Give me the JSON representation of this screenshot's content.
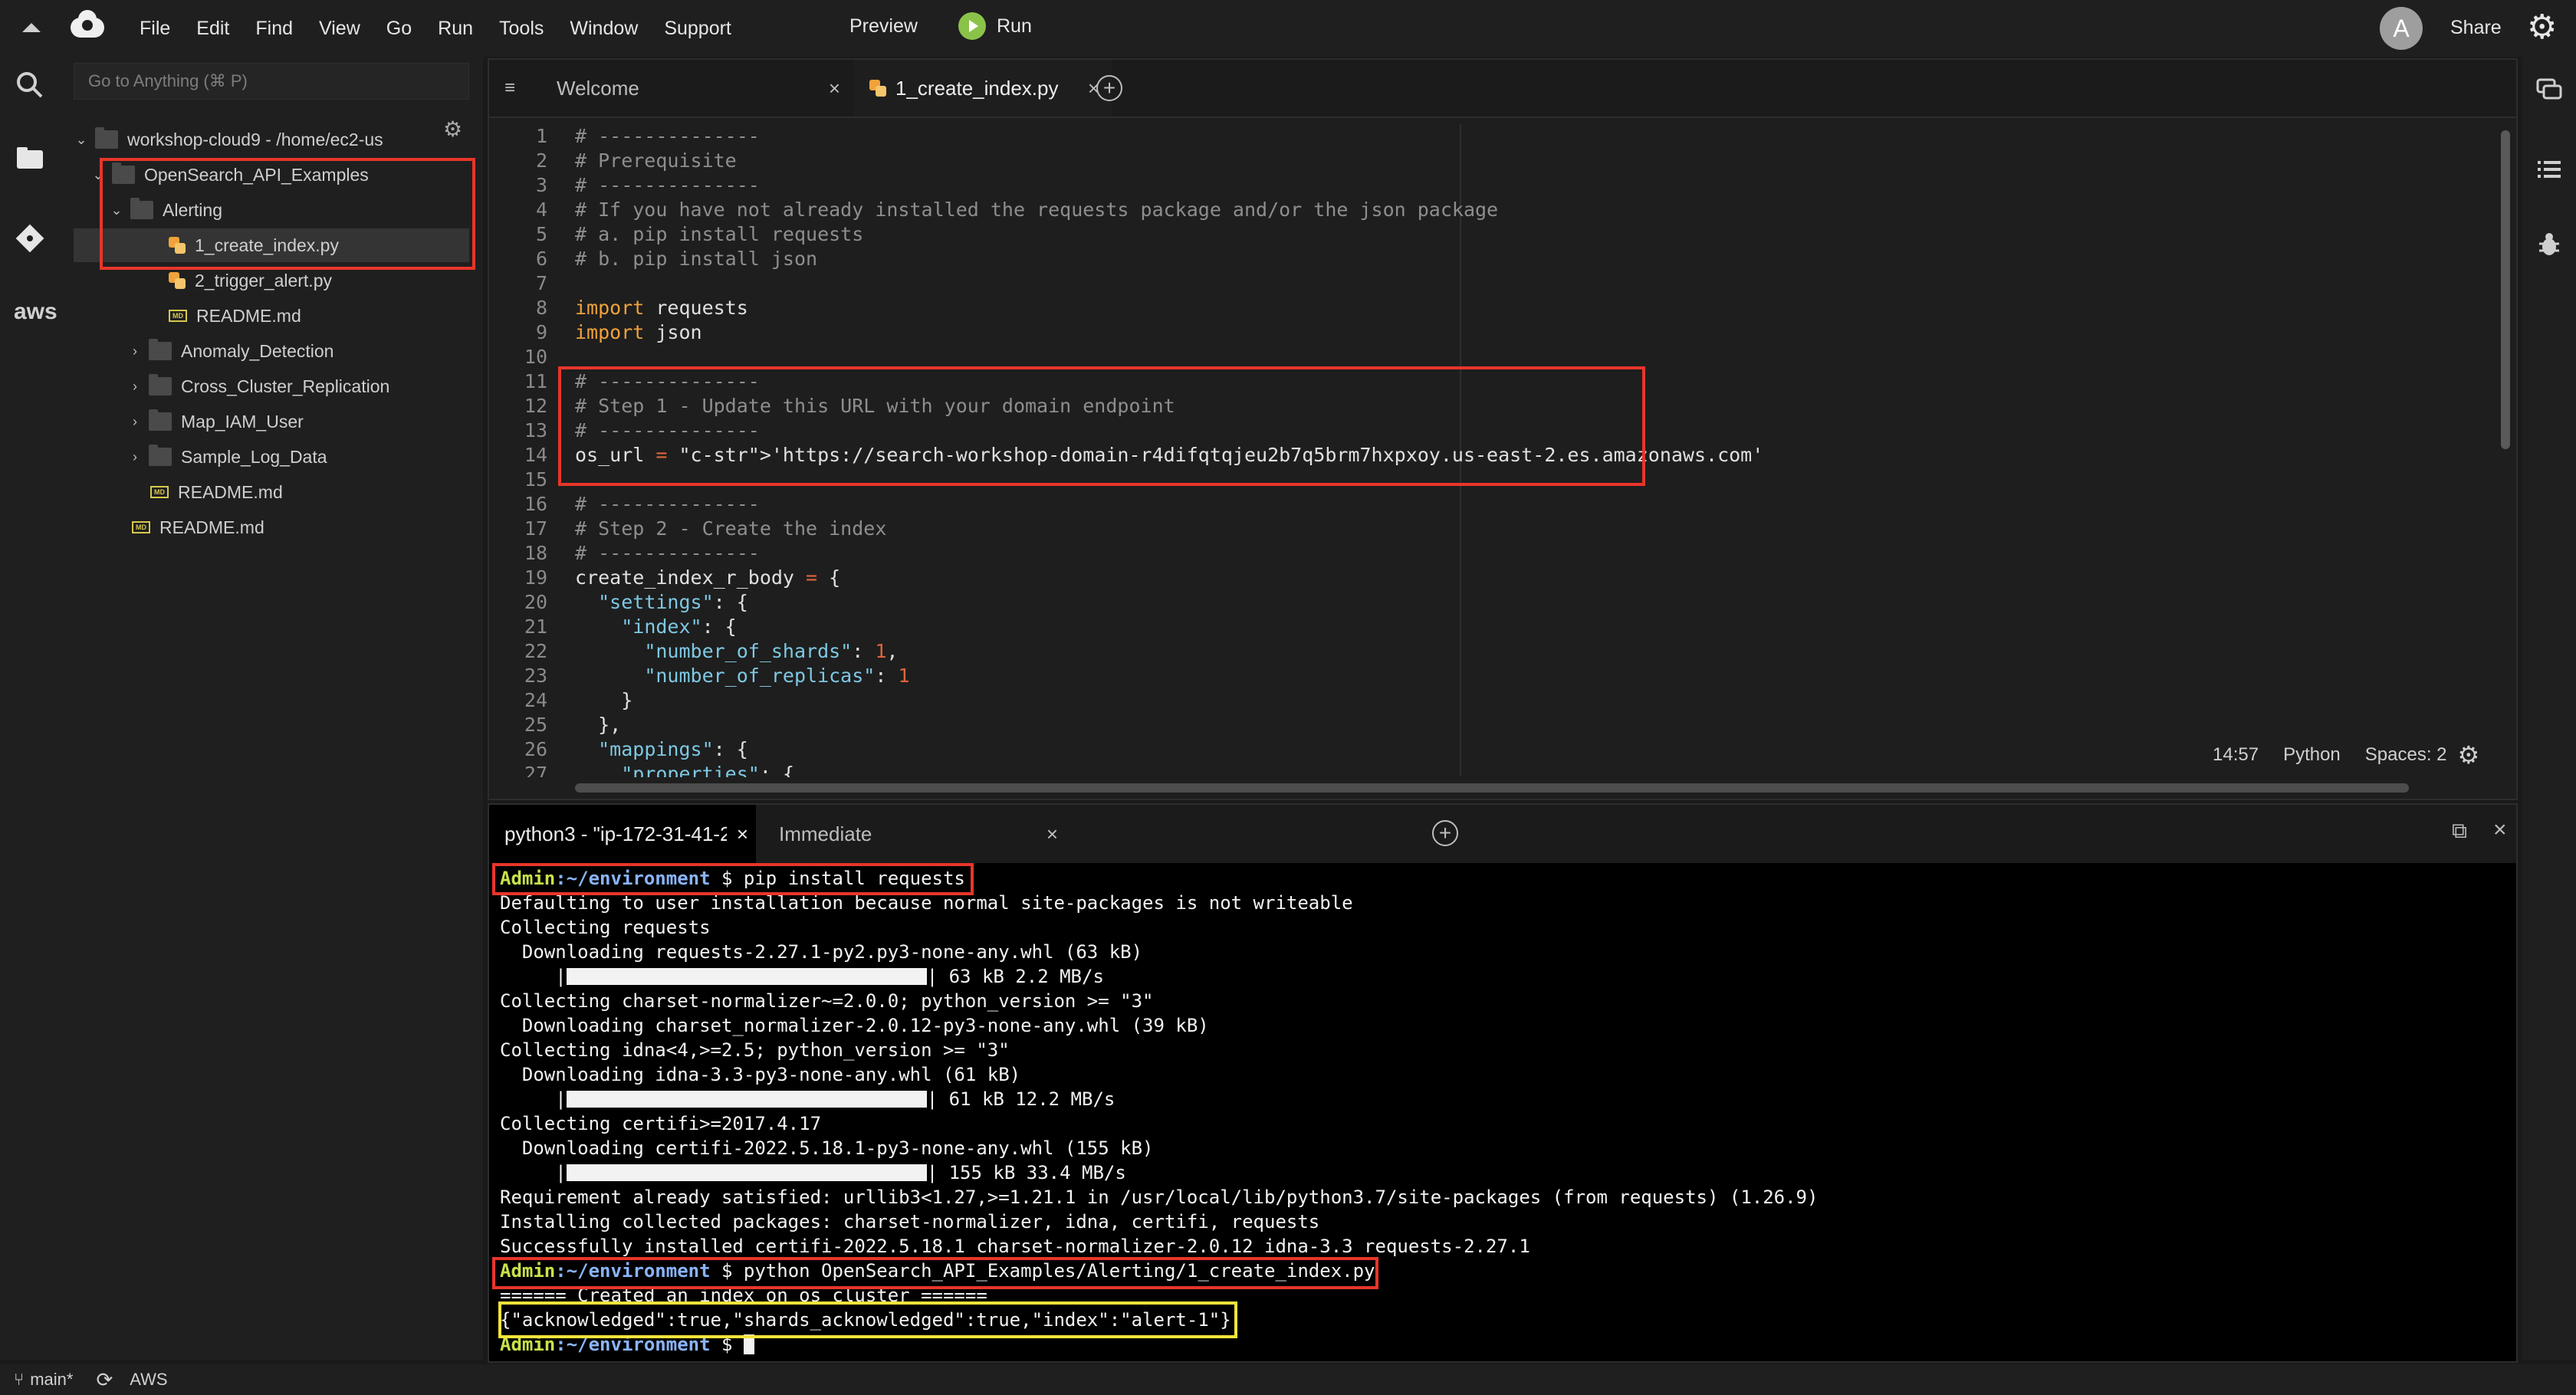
{
  "menubar": {
    "items": [
      "File",
      "Edit",
      "Find",
      "View",
      "Go",
      "Run",
      "Tools",
      "Window",
      "Support"
    ],
    "preview_label": "Preview",
    "run_label": "Run",
    "avatar_initial": "A",
    "share_label": "Share"
  },
  "sidebar": {
    "goto_placeholder": "Go to Anything (⌘ P)",
    "tree": [
      {
        "label": "workshop-cloud9 - /home/ec2-us",
        "type": "folder",
        "expanded": true
      },
      {
        "label": "OpenSearch_API_Examples",
        "type": "folder",
        "expanded": true
      },
      {
        "label": "Alerting",
        "type": "folder",
        "expanded": true
      },
      {
        "label": "1_create_index.py",
        "type": "python",
        "selected": true
      },
      {
        "label": "2_trigger_alert.py",
        "type": "python"
      },
      {
        "label": "README.md",
        "type": "markdown"
      },
      {
        "label": "Anomaly_Detection",
        "type": "folder",
        "expanded": false
      },
      {
        "label": "Cross_Cluster_Replication",
        "type": "folder",
        "expanded": false
      },
      {
        "label": "Map_IAM_User",
        "type": "folder",
        "expanded": false
      },
      {
        "label": "Sample_Log_Data",
        "type": "folder",
        "expanded": false
      },
      {
        "label": "README.md",
        "type": "markdown"
      },
      {
        "label": "README.md",
        "type": "markdown"
      }
    ],
    "rail_icons": [
      "search-icon",
      "folder-icon",
      "git-icon",
      "aws-icon"
    ],
    "aws_label": "aws",
    "md_badge": "MD"
  },
  "editor": {
    "tabs": [
      {
        "label": "Welcome",
        "active": false
      },
      {
        "label": "1_create_index.py",
        "active": true
      }
    ],
    "lines": [
      [
        "1",
        "# --------------"
      ],
      [
        "2",
        "# Prerequisite"
      ],
      [
        "3",
        "# --------------"
      ],
      [
        "4",
        "# If you have not already installed the requests package and/or the json package"
      ],
      [
        "5",
        "# a. pip install requests"
      ],
      [
        "6",
        "# b. pip install json"
      ],
      [
        "7",
        ""
      ],
      [
        "8",
        "import requests"
      ],
      [
        "9",
        "import json"
      ],
      [
        "10",
        ""
      ],
      [
        "11",
        "# --------------"
      ],
      [
        "12",
        "# Step 1 - Update this URL with your domain endpoint"
      ],
      [
        "13",
        "# --------------"
      ],
      [
        "14",
        "os_url = 'https://search-workshop-domain-r4difqtqjeu2b7q5brm7hxpxoy.us-east-2.es.amazonaws.com'"
      ],
      [
        "15",
        ""
      ],
      [
        "16",
        "# --------------"
      ],
      [
        "17",
        "# Step 2 - Create the index"
      ],
      [
        "18",
        "# --------------"
      ],
      [
        "19",
        "create_index_r_body = {"
      ],
      [
        "20",
        "  \"settings\": {"
      ],
      [
        "21",
        "    \"index\": {"
      ],
      [
        "22",
        "      \"number_of_shards\": 1,"
      ],
      [
        "23",
        "      \"number_of_replicas\": 1"
      ],
      [
        "24",
        "    }"
      ],
      [
        "25",
        "  },"
      ],
      [
        "26",
        "  \"mappings\": {"
      ],
      [
        "27",
        "    \"properties\": {"
      ]
    ],
    "status": {
      "position": "14:57",
      "language": "Python",
      "indent": "Spaces: 2"
    }
  },
  "terminal": {
    "tabs": [
      {
        "label": "python3 - \"ip-172-31-41-2",
        "active": true
      },
      {
        "label": "Immediate",
        "active": false
      }
    ],
    "prompt_user": "Admin",
    "prompt_dir": ":~/environment",
    "lines": [
      {
        "kind": "prompt",
        "cmd": " $ pip install requests"
      },
      {
        "kind": "text",
        "text": "Defaulting to user installation because normal site-packages is not writeable"
      },
      {
        "kind": "text",
        "text": "Collecting requests"
      },
      {
        "kind": "text",
        "text": "  Downloading requests-2.27.1-py2.py3-none-any.whl (63 kB)"
      },
      {
        "kind": "bar",
        "text": "| 63 kB 2.2 MB/s"
      },
      {
        "kind": "text",
        "text": "Collecting charset-normalizer~=2.0.0; python_version >= \"3\""
      },
      {
        "kind": "text",
        "text": "  Downloading charset_normalizer-2.0.12-py3-none-any.whl (39 kB)"
      },
      {
        "kind": "text",
        "text": "Collecting idna<4,>=2.5; python_version >= \"3\""
      },
      {
        "kind": "text",
        "text": "  Downloading idna-3.3-py3-none-any.whl (61 kB)"
      },
      {
        "kind": "bar",
        "text": "| 61 kB 12.2 MB/s"
      },
      {
        "kind": "text",
        "text": "Collecting certifi>=2017.4.17"
      },
      {
        "kind": "text",
        "text": "  Downloading certifi-2022.5.18.1-py3-none-any.whl (155 kB)"
      },
      {
        "kind": "bar",
        "text": "| 155 kB 33.4 MB/s"
      },
      {
        "kind": "text",
        "text": "Requirement already satisfied: urllib3<1.27,>=1.21.1 in /usr/local/lib/python3.7/site-packages (from requests) (1.26.9)"
      },
      {
        "kind": "text",
        "text": "Installing collected packages: charset-normalizer, idna, certifi, requests"
      },
      {
        "kind": "text",
        "text": "Successfully installed certifi-2022.5.18.1 charset-normalizer-2.0.12 idna-3.3 requests-2.27.1"
      },
      {
        "kind": "prompt",
        "cmd": " $ python OpenSearch_API_Examples/Alerting/1_create_index.py"
      },
      {
        "kind": "text",
        "text": "====== Created an index on os cluster ======"
      },
      {
        "kind": "text",
        "text": "{\"acknowledged\":true,\"shards_acknowledged\":true,\"index\":\"alert-1\"}"
      },
      {
        "kind": "prompt_cursor",
        "cmd": " $ "
      }
    ]
  },
  "bottombar": {
    "branch": "main*",
    "region_label": "AWS"
  },
  "colors": {
    "highlight_red": "#e8352a",
    "highlight_yellow": "#f5e33a",
    "run_green": "#8bc34a",
    "prompt_green": "#c8e24a"
  }
}
